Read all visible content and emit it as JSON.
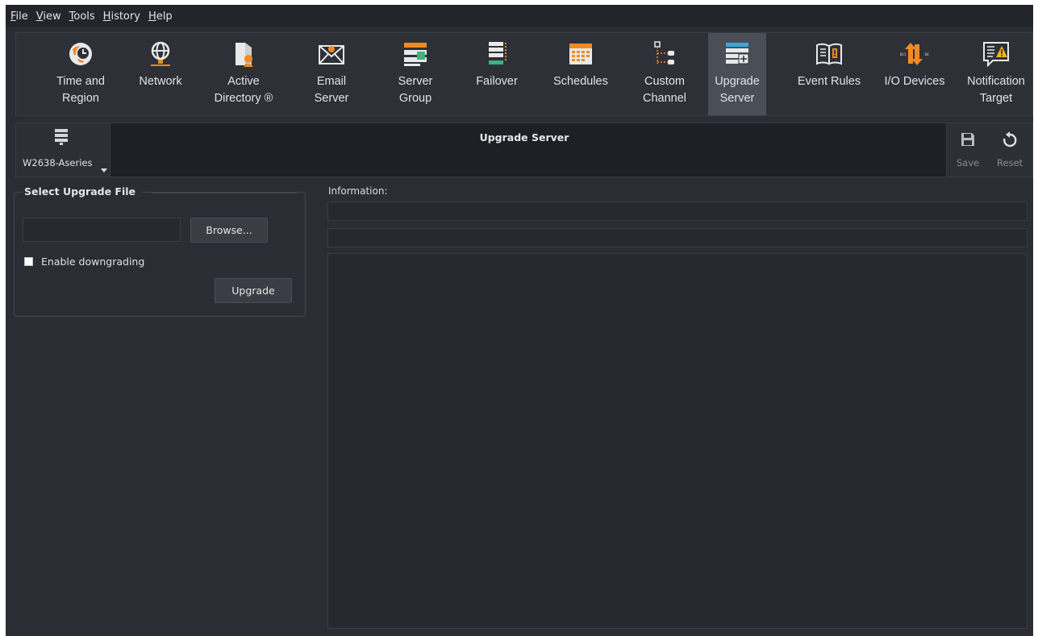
{
  "menu": [
    {
      "mnemonic": "F",
      "rest": "ile"
    },
    {
      "mnemonic": "V",
      "rest": "iew"
    },
    {
      "mnemonic": "T",
      "rest": "ools"
    },
    {
      "mnemonic": "H",
      "rest": "istory"
    },
    {
      "mnemonic": "H",
      "rest": "elp"
    }
  ],
  "toolbar": {
    "items": [
      {
        "label": "Time and\nRegion",
        "icon": "clock-globe-icon"
      },
      {
        "label": "Network",
        "icon": "network-globe-icon"
      },
      {
        "label": "Active\nDirectory ®",
        "icon": "active-directory-icon"
      },
      {
        "label": "Email\nServer",
        "icon": "email-envelope-icon"
      },
      {
        "label": "Server\nGroup",
        "icon": "server-group-icon"
      },
      {
        "label": "Failover",
        "icon": "failover-icon"
      },
      {
        "label": "Schedules",
        "icon": "calendar-grid-icon"
      },
      {
        "label": "Custom\nChannel",
        "icon": "custom-channel-tree-icon"
      },
      {
        "label": "Upgrade\nServer",
        "icon": "upgrade-server-icon"
      },
      {
        "label": "Event Rules",
        "icon": "event-rules-book-icon"
      },
      {
        "label": "I/O Devices",
        "icon": "io-devices-icon"
      },
      {
        "label": "Notification\nTarget",
        "icon": "notification-target-icon"
      }
    ],
    "active_label": "Upgrade\nServer"
  },
  "server": {
    "name": "W2638-Aseries",
    "icon": "server-icon"
  },
  "page_title": "Upgrade Server",
  "actions": {
    "save_label": "Save",
    "reset_label": "Reset"
  },
  "upgrade": {
    "group_title": "Select Upgrade File",
    "file_value": "",
    "browse_label": "Browse...",
    "downgrade_label": "Enable downgrading",
    "downgrade_checked": false,
    "upgrade_label": "Upgrade"
  },
  "information": {
    "label": "Information:",
    "line1": "",
    "line2": "",
    "details": ""
  },
  "colors": {
    "background": "#2a2d33",
    "menubar": "#22252a",
    "titlebar": "#1e2025",
    "active_tool": "#4a4e56",
    "accent_orange": "#f08a24"
  }
}
